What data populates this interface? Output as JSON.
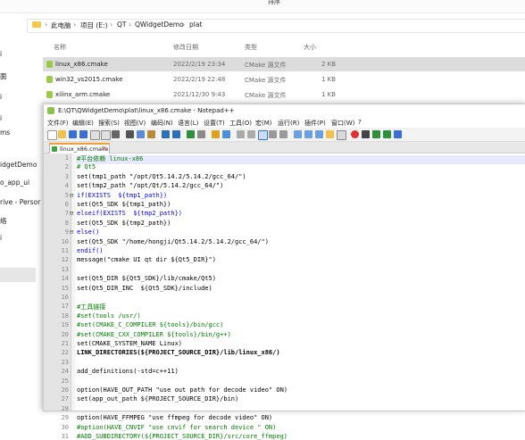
{
  "explorer": {
    "sort_label": "排序",
    "breadcrumbs": [
      "此电脑",
      "项目 (E:)",
      "QT",
      "QWidgetDemo",
      "plat"
    ],
    "columns": {
      "name": "名称",
      "date": "修改日期",
      "type": "类型",
      "size": "大小"
    },
    "files": [
      {
        "name": "linux_x86.cmake",
        "date": "2022/2/19 23:34",
        "type": "CMake 源文件",
        "size": "2 KB"
      },
      {
        "name": "win32_vs2015.cmake",
        "date": "2022/2/19 22:48",
        "type": "CMake 源文件",
        "size": "1 KB"
      },
      {
        "name": "xilinx_arm.cmake",
        "date": "2021/12/30 9:43",
        "type": "CMake 源文件",
        "size": "1 KB"
      }
    ],
    "sidebar": [
      "i",
      "面",
      "i",
      "i",
      "ms",
      "idgetDemo",
      "o_app_ui",
      "rive - Persor",
      "络",
      "i"
    ]
  },
  "npp": {
    "title": "E:\\QT\\QWidgetDemo\\plat\\linux_x86.cmake - Notepad++",
    "menu": [
      "文件(F)",
      "编辑(E)",
      "搜索(S)",
      "视图(V)",
      "编码(N)",
      "语言(L)",
      "设置(T)",
      "工具(O)",
      "宏(M)",
      "运行(R)",
      "插件(P)",
      "窗口(W)",
      "?"
    ],
    "tab_label": "linux_x86.cmake",
    "tab_close": "×",
    "lines": [
      {
        "n": "1",
        "text": "#平台依赖 linux-x86",
        "cls": "cm"
      },
      {
        "n": "2",
        "text": "# Qt5",
        "cls": "cm"
      },
      {
        "n": "3",
        "text": "set(tmp1_path \"/opt/Qt5.14.2/5.14.2/gcc_64/\")",
        "cls": ""
      },
      {
        "n": "4",
        "text": "set(tmp2_path \"/opt/Qt/5.14.2/gcc_64/\")",
        "cls": ""
      },
      {
        "n": "5",
        "text": "if(EXISTS  ${tmp1_path})",
        "cls": "kw"
      },
      {
        "n": "6",
        "text": "set(Qt5_SDK ${tmp1_path})",
        "cls": ""
      },
      {
        "n": "7",
        "text": "elseif(EXISTS  ${tmp2_path})",
        "cls": "kw"
      },
      {
        "n": "8",
        "text": "set(Qt5_SDK ${tmp2_path})",
        "cls": ""
      },
      {
        "n": "9",
        "text": "else()",
        "cls": "kw"
      },
      {
        "n": "10",
        "text": "set(Qt5_SDK \"/home/hongji/Qt5.14.2/5.14.2/gcc_64/\")",
        "cls": ""
      },
      {
        "n": "11",
        "text": "endif()",
        "cls": "kw"
      },
      {
        "n": "12",
        "text": "message(\"cmake UI qt dir ${Qt5_DIR}\")",
        "cls": ""
      },
      {
        "n": "13",
        "text": "",
        "cls": ""
      },
      {
        "n": "14",
        "text": "set(Qt5_DIR ${Qt5_SDK}/lib/cmake/Qt5)",
        "cls": ""
      },
      {
        "n": "15",
        "text": "set(Qt5_DIR_INC  ${Qt5_SDK}/include)",
        "cls": ""
      },
      {
        "n": "16",
        "text": "",
        "cls": ""
      },
      {
        "n": "17",
        "text": "#工具链接",
        "cls": "cm"
      },
      {
        "n": "18",
        "text": "#set(tools /usr/)",
        "cls": "cm"
      },
      {
        "n": "19",
        "text": "#set(CMAKE_C_COMPILER ${tools}/bin/gcc)",
        "cls": "cm"
      },
      {
        "n": "20",
        "text": "#set(CMAKE_CXX_COMPILER ${tools}/bin/g++)",
        "cls": "cm"
      },
      {
        "n": "21",
        "text": "set(CMAKE_SYSTEM_NAME Linux)",
        "cls": ""
      },
      {
        "n": "22",
        "text": "LINK_DIRECTORIES(${PROJECT_SOURCE_DIR}/lib/linux_x86/)",
        "cls": "bold"
      },
      {
        "n": "23",
        "text": "",
        "cls": ""
      },
      {
        "n": "24",
        "text": "add_definitions(-std=c++11)",
        "cls": ""
      },
      {
        "n": "25",
        "text": "",
        "cls": ""
      },
      {
        "n": "26",
        "text": "option(HAVE_OUT_PATH \"use out path for decode video\" ON)",
        "cls": ""
      },
      {
        "n": "27",
        "text": "set(app_out_path ${PROJECT_SOURCE_DIR}/bin)",
        "cls": ""
      },
      {
        "n": "28",
        "text": "",
        "cls": ""
      },
      {
        "n": "29",
        "text": "option(HAVE_FFMPEG \"use ffmpeg for decode video\" ON)",
        "cls": ""
      },
      {
        "n": "30",
        "text": "#option(HAVE_CNVIF \"use cnvif for search device \" ON)",
        "cls": "cm"
      },
      {
        "n": "31",
        "text": "#ADD_SUBDIRECTORY(${PROJECT_SOURCE_DIR}/src/core_ffmpeg)",
        "cls": "cm"
      }
    ]
  },
  "colors": {
    "accent_tab": "#f0a030",
    "comment": "#008000",
    "keyword": "#0000ff"
  }
}
